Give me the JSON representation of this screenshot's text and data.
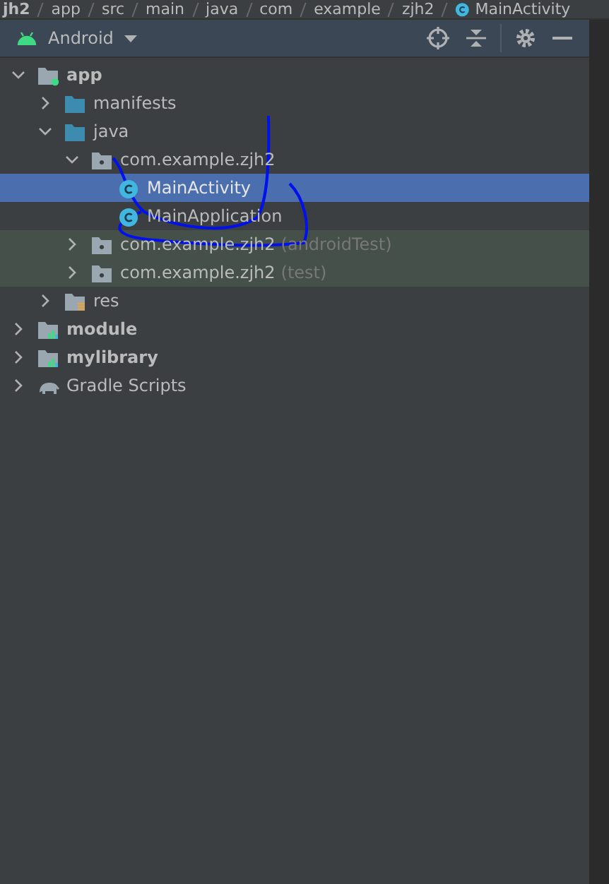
{
  "breadcrumb": [
    {
      "label": "jh2",
      "kind": "text"
    },
    {
      "label": "app",
      "kind": "text"
    },
    {
      "label": "src",
      "kind": "text"
    },
    {
      "label": "main",
      "kind": "text"
    },
    {
      "label": "java",
      "kind": "text"
    },
    {
      "label": "com",
      "kind": "text"
    },
    {
      "label": "example",
      "kind": "text"
    },
    {
      "label": "zjh2",
      "kind": "text"
    },
    {
      "label": "MainActivity",
      "kind": "class"
    }
  ],
  "toolbar": {
    "view": "Android"
  },
  "tree": [
    {
      "label": "app",
      "kind": "module",
      "expanded": true,
      "selected": false,
      "tinted": false,
      "children": [
        {
          "label": "manifests",
          "kind": "folder",
          "expanded": false,
          "selected": false,
          "tinted": false
        },
        {
          "label": "java",
          "kind": "folder",
          "expanded": true,
          "selected": false,
          "tinted": false,
          "children": [
            {
              "label": "com.example.zjh2",
              "kind": "package",
              "expanded": true,
              "selected": false,
              "tinted": false,
              "children": [
                {
                  "label": "MainActivity",
                  "kind": "class",
                  "selected": true,
                  "tinted": false
                },
                {
                  "label": "MainApplication",
                  "kind": "class",
                  "selected": false,
                  "tinted": false
                }
              ]
            },
            {
              "label": "com.example.zjh2",
              "suffix": "(androidTest)",
              "kind": "package",
              "expanded": false,
              "selected": false,
              "tinted": true
            },
            {
              "label": "com.example.zjh2",
              "suffix": "(test)",
              "kind": "package",
              "expanded": false,
              "selected": false,
              "tinted": true
            }
          ]
        },
        {
          "label": "res",
          "kind": "res",
          "expanded": false,
          "selected": false,
          "tinted": false
        }
      ]
    },
    {
      "label": "module",
      "kind": "library",
      "expanded": false,
      "selected": false,
      "tinted": false
    },
    {
      "label": "mylibrary",
      "kind": "library",
      "expanded": false,
      "selected": false,
      "tinted": false
    },
    {
      "label": "Gradle Scripts",
      "kind": "gradle",
      "expanded": false,
      "selected": false,
      "tinted": false
    }
  ]
}
